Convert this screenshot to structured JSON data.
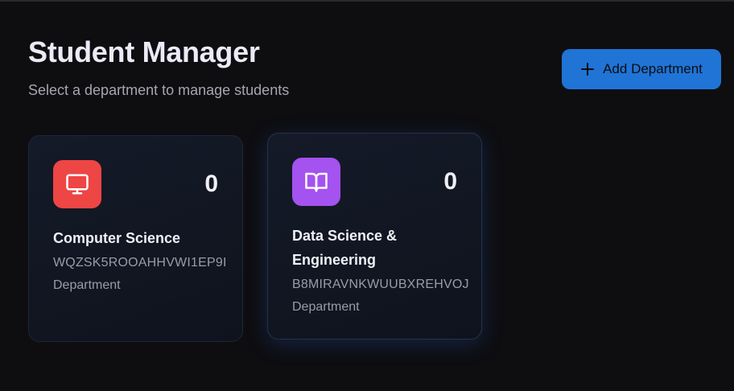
{
  "header": {
    "title": "Student Manager",
    "subtitle": "Select a department to manage students",
    "add_button_label": "Add Department",
    "add_button_icon": "plus-icon"
  },
  "departments": [
    {
      "name": "Computer Science",
      "code": "WQZSK5ROOAHHVWI1EP9I",
      "type": "Department",
      "count": "0",
      "icon": "monitor-icon",
      "icon_color": "#ee4545"
    },
    {
      "name": "Data Science & Engineering",
      "code": "B8MIRAVNKWUUBXREHVOJ",
      "type": "Department",
      "count": "0",
      "icon": "book-open-icon",
      "icon_color": "#a452f0"
    }
  ],
  "colors": {
    "background": "#0e0e11",
    "accent": "#1f74d6",
    "card_bg": "#141a28"
  }
}
